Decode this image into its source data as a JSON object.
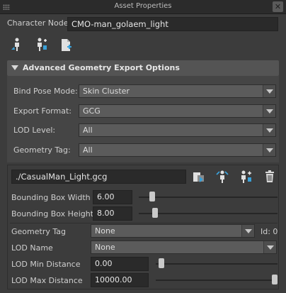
{
  "window": {
    "title": "Asset Properties",
    "close_glyph": "✕"
  },
  "character_node": {
    "label": "Character Node",
    "value": "CMO-man_golaem_light"
  },
  "toolbar": {
    "icons": [
      "character-select-icon",
      "character-add-icon",
      "add-file-icon"
    ]
  },
  "geometry_export": {
    "header": "Advanced Geometry Export Options",
    "bind_pose_mode": {
      "label": "Bind Pose Mode:",
      "value": "Skin Cluster"
    },
    "export_format": {
      "label": "Export Format:",
      "value": "GCG"
    },
    "lod_level": {
      "label": "LOD Level:",
      "value": "All"
    },
    "geometry_tag": {
      "label": "Geometry Tag:",
      "value": "All"
    }
  },
  "geometry_file": {
    "path": "./CasualMan_Light.gcg",
    "bounding_box_width": {
      "label": "Bounding Box Width",
      "value": "6.00",
      "slider_fraction": 0.06
    },
    "bounding_box_height": {
      "label": "Bounding Box Height",
      "value": "8.00",
      "slider_fraction": 0.08
    },
    "geometry_tag": {
      "label": "Geometry Tag",
      "value": "None",
      "id_label": "Id: 0"
    },
    "lod_name": {
      "label": "LOD Name",
      "value": "None"
    },
    "lod_min_distance": {
      "label": "LOD Min Distance",
      "value": "0.00",
      "slider_fraction": 0.0
    },
    "lod_max_distance": {
      "label": "LOD Max Distance",
      "value": "10000.00",
      "slider_fraction": 1.0
    }
  }
}
